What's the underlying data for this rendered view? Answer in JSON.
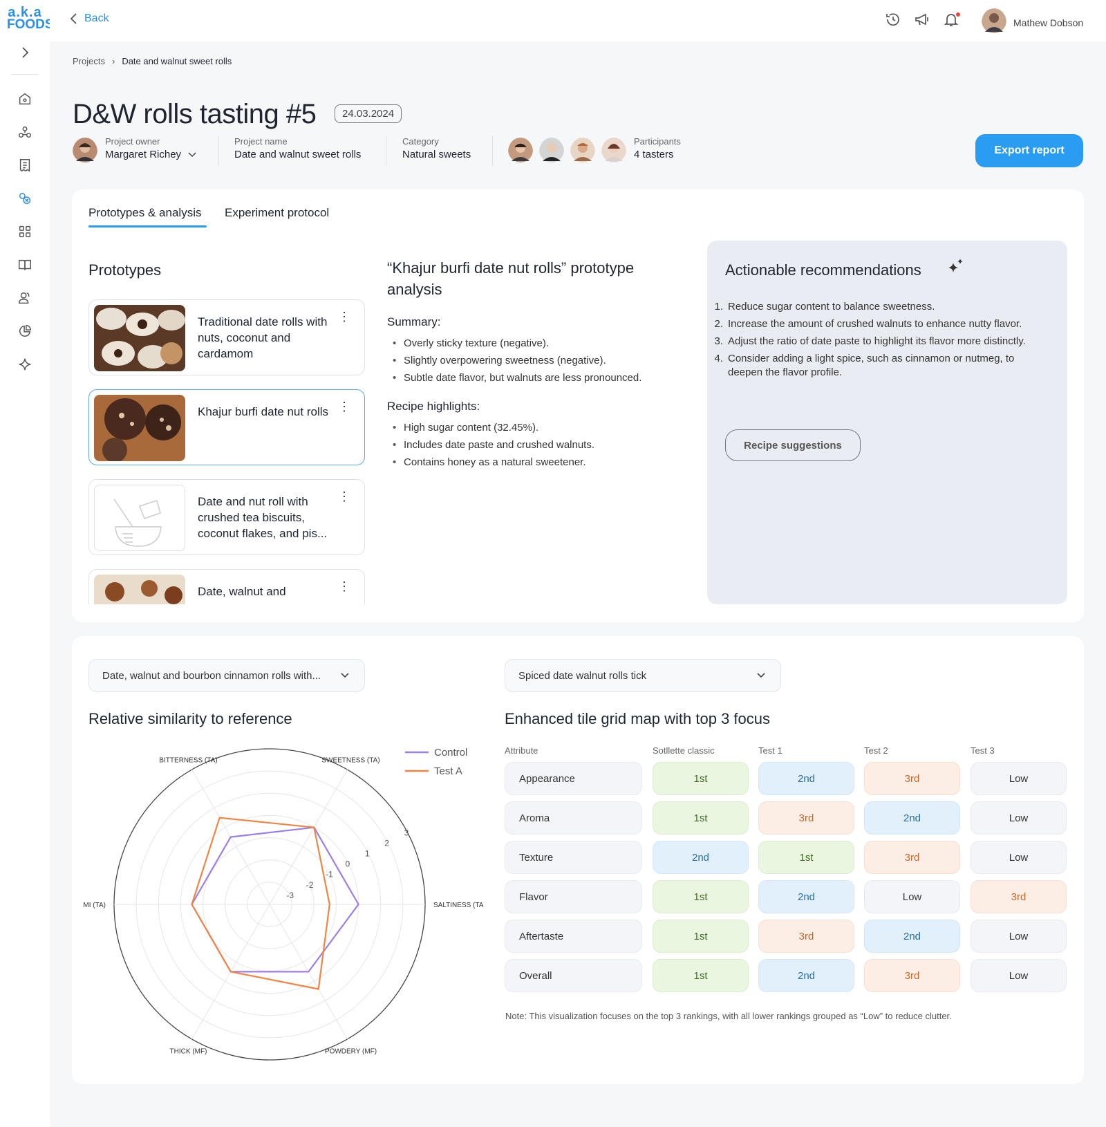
{
  "brand": {
    "line1": "a.k.a",
    "line2": "FOODS"
  },
  "topbar": {
    "back_label": "Back",
    "user_name": "Mathew Dobson"
  },
  "breadcrumb": {
    "root": "Projects",
    "separator": "›",
    "current": "Date and walnut sweet rolls"
  },
  "page": {
    "title": "D&W rolls tasting #5",
    "date": "24.03.2024",
    "export_label": "Export report"
  },
  "meta": {
    "owner_label": "Project owner",
    "owner_value": "Margaret Richey",
    "project_label": "Project name",
    "project_value": "Date and walnut sweet rolls",
    "category_label": "Category",
    "category_value": "Natural sweets",
    "participants_label": "Participants",
    "participants_value": "4 tasters"
  },
  "tabs": {
    "tab1": "Prototypes & analysis",
    "tab2": "Experiment protocol"
  },
  "prototypes": {
    "heading": "Prototypes",
    "items": [
      {
        "title": "Traditional date rolls with nuts, coconut and cardamom"
      },
      {
        "title": "Khajur burfi date nut rolls"
      },
      {
        "title": "Date and nut roll with crushed tea biscuits, coconut flakes, and pis..."
      },
      {
        "title": "Date, walnut and"
      }
    ]
  },
  "analysis": {
    "heading": "“Khajur burfi date nut rolls” prototype analysis",
    "summary_label": "Summary:",
    "summary": [
      "Overly sticky texture (negative).",
      "Slightly overpowering sweetness (negative).",
      "Subtle date flavor, but walnuts are less pronounced."
    ],
    "highlights_label": "Recipe highlights:",
    "highlights": [
      "High sugar content (32.45%).",
      "Includes date paste and crushed walnuts.",
      "Contains honey as a natural sweetener."
    ]
  },
  "recommendations": {
    "heading": "Actionable recommendations",
    "items": [
      {
        "n": "1.",
        "text": "Reduce sugar content to balance sweetness."
      },
      {
        "n": "2.",
        "text": "Increase the amount of crushed walnuts to enhance nutty flavor."
      },
      {
        "n": "3.",
        "text": "Adjust the ratio of date paste to highlight its flavor more distinctly."
      },
      {
        "n": "4.",
        "text": "Consider adding a light spice, such as cinnamon or nutmeg, to deepen the flavor profile."
      }
    ],
    "button_label": "Recipe suggestions"
  },
  "selects": {
    "left": "Date, walnut and bourbon cinnamon rolls with...",
    "right": "Spiced date walnut rolls tick"
  },
  "radar": {
    "heading": "Relative similarity to reference"
  },
  "chart_data": {
    "type": "radar",
    "axes": [
      "SWEETNESS (TA)",
      "SALTINESS (TA)",
      "POWDERY (MF)",
      "THICK (MF)",
      "UMAMI (TA)",
      "BITTERNESS (TA)"
    ],
    "rlim": [
      -4,
      3
    ],
    "ticks": [
      "-3",
      "-2",
      "-1",
      "0",
      "1",
      "2",
      "3"
    ],
    "series": [
      {
        "name": "Control",
        "color": "#9b7fe6",
        "values": [
          0,
          0,
          -0.5,
          -0.5,
          -0.5,
          -0.5
        ]
      },
      {
        "name": "Test A",
        "color": "#f08443",
        "values": [
          0,
          -1.3,
          0.4,
          -0.5,
          -0.5,
          0.5
        ]
      }
    ],
    "legend": "top-right"
  },
  "grid": {
    "heading": "Enhanced tile grid map with top 3 focus",
    "columns": [
      "Attribute",
      "Sotllette classic",
      "Test 1",
      "Test 2",
      "Test 3"
    ],
    "rows": [
      {
        "attr": "Appearance",
        "vals": [
          "1st",
          "2nd",
          "3rd",
          "Low"
        ]
      },
      {
        "attr": "Aroma",
        "vals": [
          "1st",
          "3rd",
          "2nd",
          "Low"
        ]
      },
      {
        "attr": "Texture",
        "vals": [
          "2nd",
          "1st",
          "3rd",
          "Low"
        ]
      },
      {
        "attr": "Flavor",
        "vals": [
          "1st",
          "2nd",
          "Low",
          "3rd"
        ]
      },
      {
        "attr": "Aftertaste",
        "vals": [
          "1st",
          "3rd",
          "2nd",
          "Low"
        ]
      },
      {
        "attr": "Overall",
        "vals": [
          "1st",
          "2nd",
          "3rd",
          "Low"
        ]
      }
    ],
    "note": "Note: This visualization focuses on the top 3 rankings, with all lower rankings grouped as “Low” to reduce clutter."
  }
}
